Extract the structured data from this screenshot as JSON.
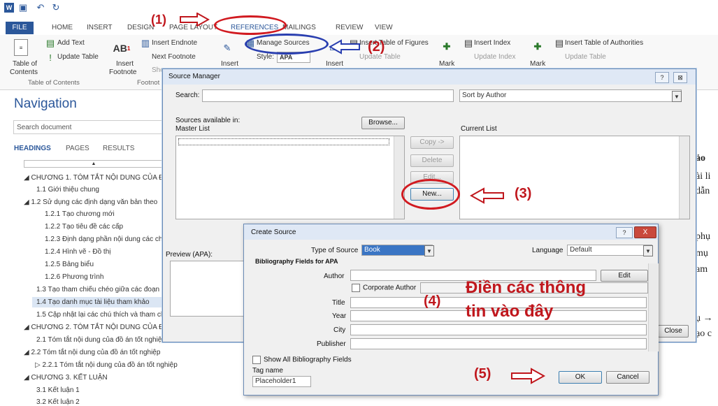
{
  "window": {
    "title_icons": [
      "word-icon",
      "save-icon",
      "undo-icon",
      "redo-icon"
    ]
  },
  "ribbon": {
    "tabs": [
      "FILE",
      "HOME",
      "INSERT",
      "DESIGN",
      "PAGE LAYOUT",
      "REFERENCES",
      "MAILINGS",
      "REVIEW",
      "VIEW"
    ],
    "toc_label_1": "Table of",
    "toc_label_2": "Contents",
    "add_text": "Add Text",
    "update_table": "Update Table",
    "group_toc": "Table of Contents",
    "insert_endnote": "Insert Endnote",
    "next_footnote": "Next Footnote",
    "show_notes": "Sho",
    "insert_footnote_1": "Insert",
    "insert_footnote_2": "Footnote",
    "group_footnotes": "Footnot",
    "manage_sources": "Manage Sources",
    "style_label": "Style:",
    "style_value": "APA",
    "insert_citation": "Insert",
    "insert_caption": "Insert",
    "insert_table_figures": "Insert Table of Figures",
    "update_table_2": "Update Table",
    "insert_index": "Insert Index",
    "update_index": "Update Index",
    "mark_1": "Mark",
    "mark_2": "Mark",
    "insert_table_authorities": "Insert Table of Authorities",
    "update_table_3": "Update Table"
  },
  "navigation": {
    "title": "Navigation",
    "search_placeholder": "Search document",
    "tabs": [
      "HEADINGS",
      "PAGES",
      "RESULTS"
    ],
    "items": [
      {
        "text": "◢  CHƯƠNG 1. TÓM TẮT NỘI DUNG CỦA ĐỒ Á"
      },
      {
        "text": "1.1 Giới thiệu chung"
      },
      {
        "text": "◢  1.2 Sử dụng các định dạng văn bản theo"
      },
      {
        "text": "1.2.1 Tạo chương mới"
      },
      {
        "text": "1.2.2 Tạo tiêu đề các cấp"
      },
      {
        "text": "1.2.3 Định dạng phần nội dung các ch"
      },
      {
        "text": "1.2.4 Hình vẽ - Đồ thị"
      },
      {
        "text": "1.2.5 Bảng biểu"
      },
      {
        "text": "1.2.6 Phương trình"
      },
      {
        "text": "1.3 Tạo tham chiếu chéo giữa các đoạn v"
      },
      {
        "text": "1.4 Tạo danh mục tài liệu tham khảo"
      },
      {
        "text": "1.5 Cập nhật lại các chú thích và tham ch"
      },
      {
        "text": "◢  CHƯƠNG 2. TÓM TẮT NỘI DUNG CỦA ĐỒ Á"
      },
      {
        "text": "2.1 Tóm tắt nội dung của đồ án tốt nghiệ"
      },
      {
        "text": "◢  2.2 Tóm tắt nội dung của đồ án tốt nghiệp"
      },
      {
        "text": "▷  2.2.1 Tóm tắt nội dung của đồ án tốt nghiệp"
      },
      {
        "text": "◢  CHƯƠNG 3. KẾT LUẬN"
      },
      {
        "text": "3.1 Kết luận 1"
      },
      {
        "text": "3.2 Kết luận 2"
      }
    ]
  },
  "document": {
    "fragments": [
      "ảo",
      "ài li",
      "dẫn",
      "phụ",
      "mụ",
      "am",
      "ụ →",
      "ạo c"
    ]
  },
  "source_manager": {
    "title": "Source Manager",
    "search_label": "Search:",
    "sort_value": "Sort by Author",
    "sources_available": "Sources available in:",
    "master_list": "Master List",
    "browse": "Browse...",
    "current_list": "Current List",
    "copy": "Copy ->",
    "delete": "Delete",
    "edit": "Edit...",
    "new": "New...",
    "preview": "Preview (APA):",
    "close": "Close",
    "help_btn": "?",
    "close_x": "⊠"
  },
  "create_source": {
    "title": "Create Source",
    "type_label": "Type of Source",
    "type_value": "Book",
    "language_label": "Language",
    "language_value": "Default",
    "bib_fields": "Bibliography Fields for APA",
    "author": "Author",
    "edit": "Edit",
    "corporate_author": "Corporate Author",
    "title_field": "Title",
    "year": "Year",
    "city": "City",
    "publisher": "Publisher",
    "show_all": "Show All Bibliography Fields",
    "tag_name": "Tag name",
    "tag_value": "Placeholder1",
    "ok": "OK",
    "cancel": "Cancel",
    "help_btn": "?",
    "close_x": "X"
  },
  "annotations": {
    "step1": "(1)",
    "step2": "(2)",
    "step3": "(3)",
    "step4": "(4)",
    "step5": "(5)",
    "note_line1": "Điền các thông",
    "note_line2": "tin vào đây",
    "color": "#c0171d"
  }
}
